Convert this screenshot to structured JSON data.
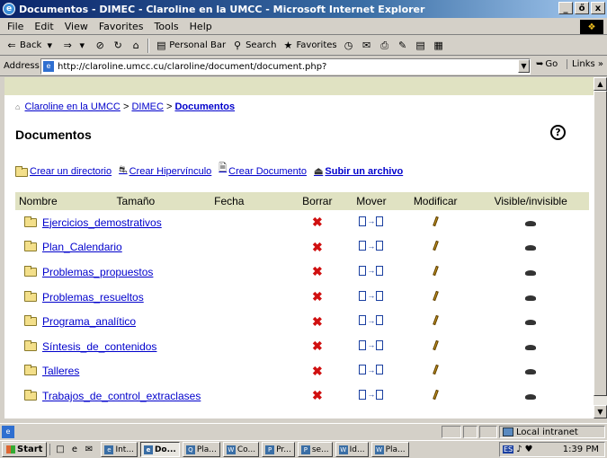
{
  "window": {
    "title": "Documentos - DIMEC - Claroline en la UMCC - Microsoft Internet Explorer",
    "minimize": "_",
    "restore": "ő",
    "close": "x"
  },
  "menu": [
    "File",
    "Edit",
    "View",
    "Favorites",
    "Tools",
    "Help"
  ],
  "toolbar": {
    "back": "Back",
    "personal_bar": "Personal Bar",
    "search": "Search",
    "favorites": "Favorites"
  },
  "address": {
    "label": "Address",
    "url": "http://claroline.umcc.cu/claroline/document/document.php?",
    "go": "Go",
    "links": "Links"
  },
  "breadcrumb": {
    "home": "Claroline en la UMCC",
    "sep1": ">",
    "course": "DIMEC",
    "sep2": ">",
    "current": "Documentos"
  },
  "page_title": "Documentos",
  "actions": {
    "create_dir": "Crear un directorio",
    "create_link": "Crear Hipervínculo",
    "create_doc": "Crear Documento",
    "upload": "Subir un archivo"
  },
  "table": {
    "headers": {
      "name": "Nombre",
      "size": "Tamaño",
      "date": "Fecha",
      "delete": "Borrar",
      "move": "Mover",
      "modify": "Modificar",
      "visible": "Visible/invisible"
    },
    "rows": [
      {
        "name": "Ejercicios_demostrativos"
      },
      {
        "name": "Plan_Calendario"
      },
      {
        "name": "Problemas_propuestos"
      },
      {
        "name": "Problemas_resueltos"
      },
      {
        "name": "Programa_analítico"
      },
      {
        "name": "Síntesis_de_contenidos"
      },
      {
        "name": "Talleres"
      },
      {
        "name": "Trabajos_de_control_extraclases"
      }
    ]
  },
  "status": {
    "zone": "Local intranet"
  },
  "taskbar": {
    "start": "Start",
    "buttons": [
      "Int...",
      "Do...",
      "Pla...",
      "Co...",
      "Pr...",
      "se...",
      "Id...",
      "Pla..."
    ],
    "lang": "ES",
    "clock": "1:39 PM"
  }
}
